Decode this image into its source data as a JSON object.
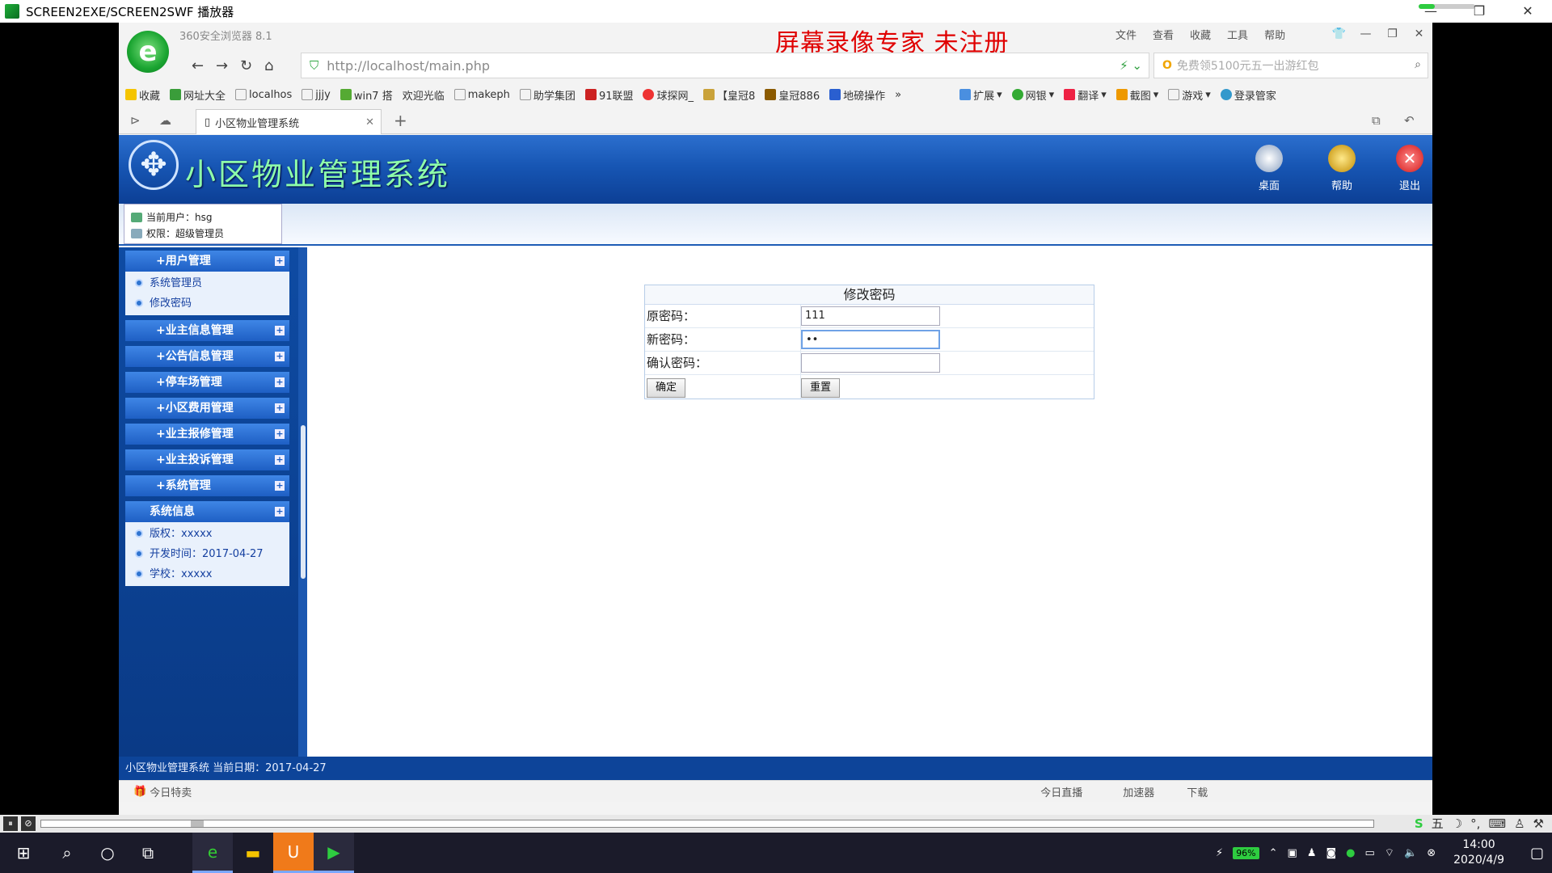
{
  "player": {
    "title": "SCREEN2EXE/SCREEN2SWF 播放器",
    "controls": [
      "⏸",
      "⊘"
    ]
  },
  "browser": {
    "name_version": "360安全浏览器 8.1",
    "watermark": "屏幕录像专家  未注册",
    "menu": [
      "文件",
      "查看",
      "收藏",
      "工具",
      "帮助"
    ],
    "url": "http://localhost/main.php",
    "search_placeholder": "免费领5100元五一出游红包",
    "favorites": [
      "收藏",
      "网址大全",
      "localhos",
      "jjjy",
      "win7 搭",
      "欢迎光临",
      "makeph",
      "助学集团",
      "91联盟",
      "球探网_",
      "【皇冠8",
      "皇冠886",
      "地磅操作"
    ],
    "toolbar_right": [
      "扩展",
      "网银",
      "翻译",
      "截图",
      "游戏",
      "登录管家"
    ],
    "tab_title": "小区物业管理系统",
    "status_left": "今日特卖",
    "status_right": [
      "今日直播",
      "加速器",
      "下载"
    ]
  },
  "site": {
    "title": "小区物业管理系统",
    "top_buttons": [
      "桌面",
      "帮助",
      "退出"
    ],
    "user_label": "当前用户：hsg",
    "role_label": "权限：超级管理员",
    "footer": "小区物业管理系统 当前日期：2017-04-27"
  },
  "sidebar": {
    "groups": [
      {
        "label": "+用户管理",
        "items": [
          "系统管理员",
          "修改密码"
        ]
      },
      {
        "label": "+业主信息管理"
      },
      {
        "label": "+公告信息管理"
      },
      {
        "label": "+停车场管理"
      },
      {
        "label": "+小区费用管理"
      },
      {
        "label": "+业主报修管理"
      },
      {
        "label": "+业主投诉管理"
      },
      {
        "label": "+系统管理"
      },
      {
        "label": "系统信息",
        "items": [
          "版权：xxxxx",
          "开发时间：2017-04-27",
          "学校：xxxxx"
        ]
      }
    ]
  },
  "form": {
    "title": "修改密码",
    "old_label": "原密码：",
    "old_value": "111",
    "new_label": "新密码：",
    "new_value": "••",
    "confirm_label": "确认密码：",
    "confirm_value": "",
    "submit": "确定",
    "reset": "重置"
  },
  "taskbar": {
    "battery": "96%",
    "time": "14:00",
    "date": "2020/4/9"
  },
  "ime": [
    "五"
  ]
}
